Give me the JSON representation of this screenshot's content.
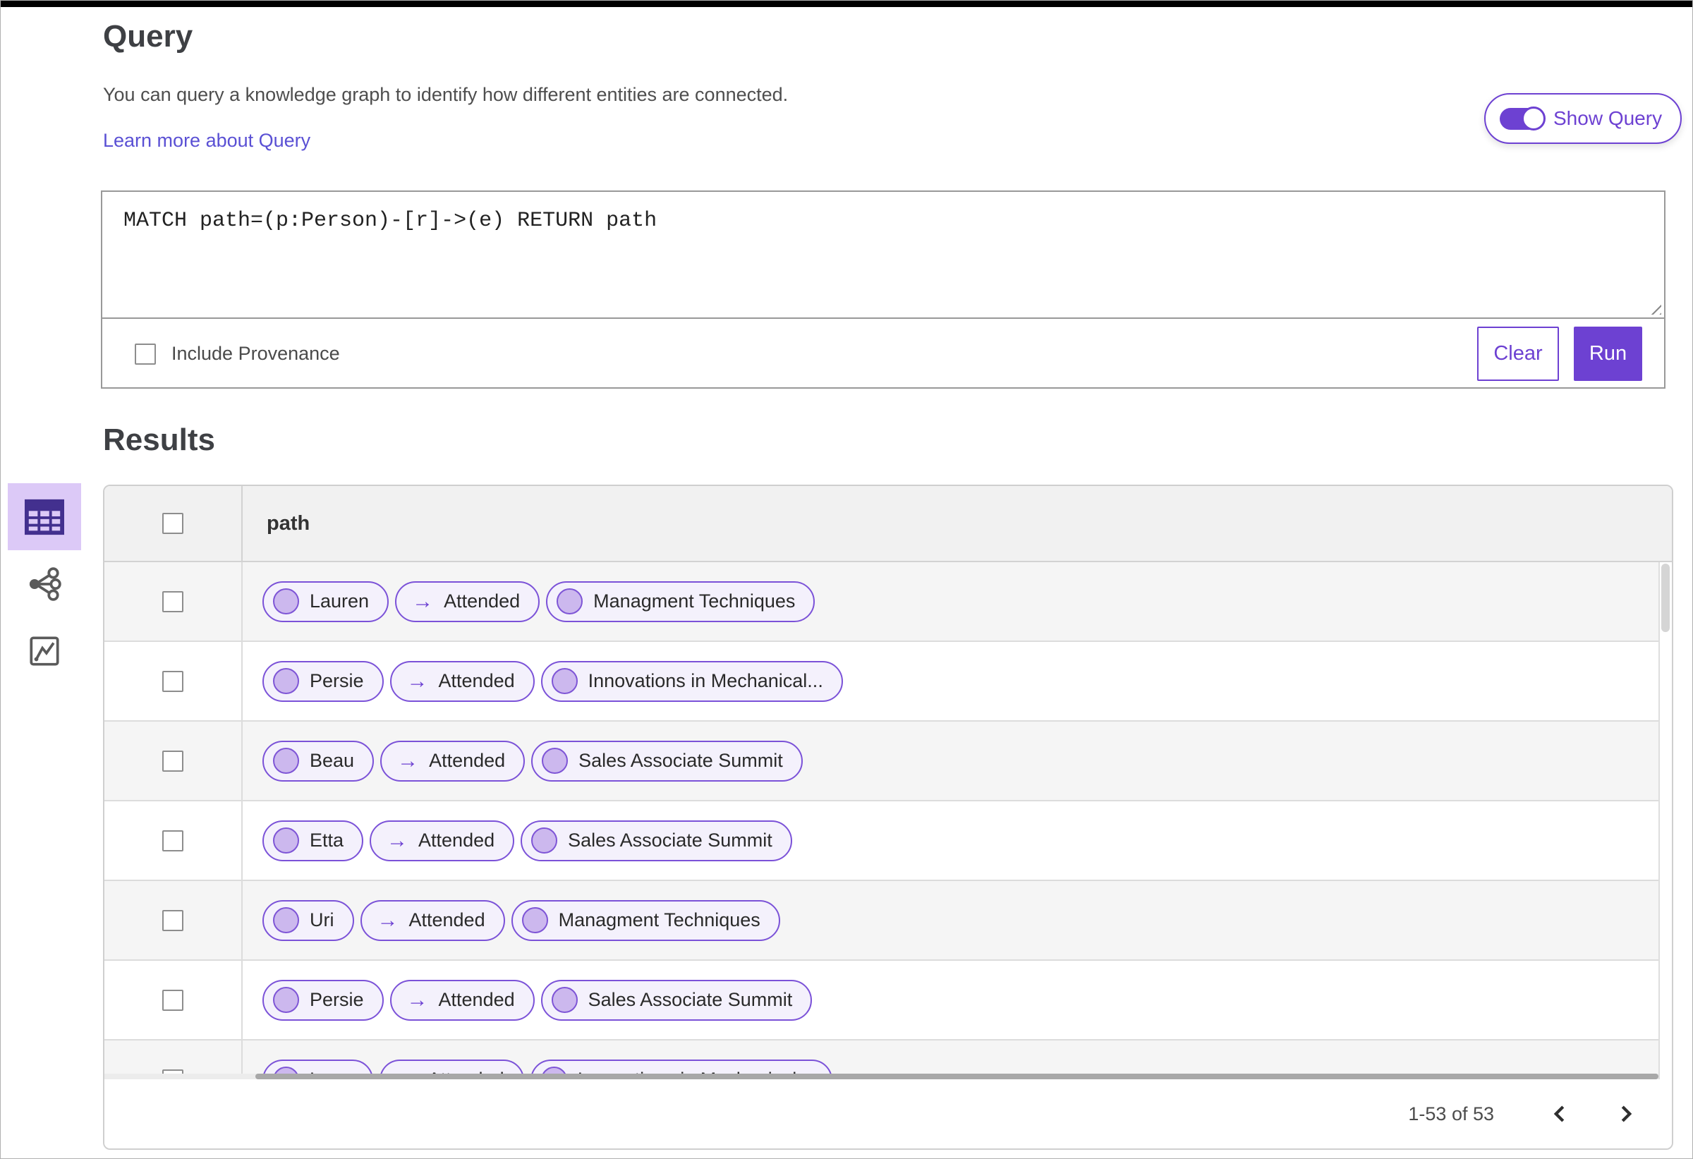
{
  "colors": {
    "accent": "#6d41d2",
    "chip_border": "#7b52d8",
    "chip_background": "#f4f1fc",
    "node_fill": "#ccb8ee",
    "selected_view_background": "#dcc9f7"
  },
  "query": {
    "title": "Query",
    "description": "You can query a knowledge graph to identify how different entities are connected.",
    "learn_more_link": "Learn more about Query",
    "show_query_toggle_label": "Show Query",
    "editor_value": "MATCH path=(p:Person)-[r]->(e) RETURN path",
    "include_provenance_label": "Include Provenance",
    "clear_button": "Clear",
    "run_button": "Run"
  },
  "results": {
    "title": "Results",
    "columns": [
      "path"
    ],
    "arrow": "→",
    "view_icons": [
      "table-view-icon",
      "network-view-icon",
      "chart-view-icon"
    ],
    "rows": [
      {
        "source": "Lauren",
        "relation": "Attended",
        "target": "Managment Techniques"
      },
      {
        "source": "Persie",
        "relation": "Attended",
        "target": "Innovations in Mechanical..."
      },
      {
        "source": "Beau",
        "relation": "Attended",
        "target": "Sales Associate Summit"
      },
      {
        "source": "Etta",
        "relation": "Attended",
        "target": "Sales Associate Summit"
      },
      {
        "source": "Uri",
        "relation": "Attended",
        "target": "Managment Techniques"
      },
      {
        "source": "Persie",
        "relation": "Attended",
        "target": "Sales Associate Summit"
      },
      {
        "source": "Larry",
        "relation": "Attended",
        "target": "Innovations in Mechanical..."
      }
    ],
    "pagination": {
      "range_label": "1-53 of 53"
    }
  }
}
